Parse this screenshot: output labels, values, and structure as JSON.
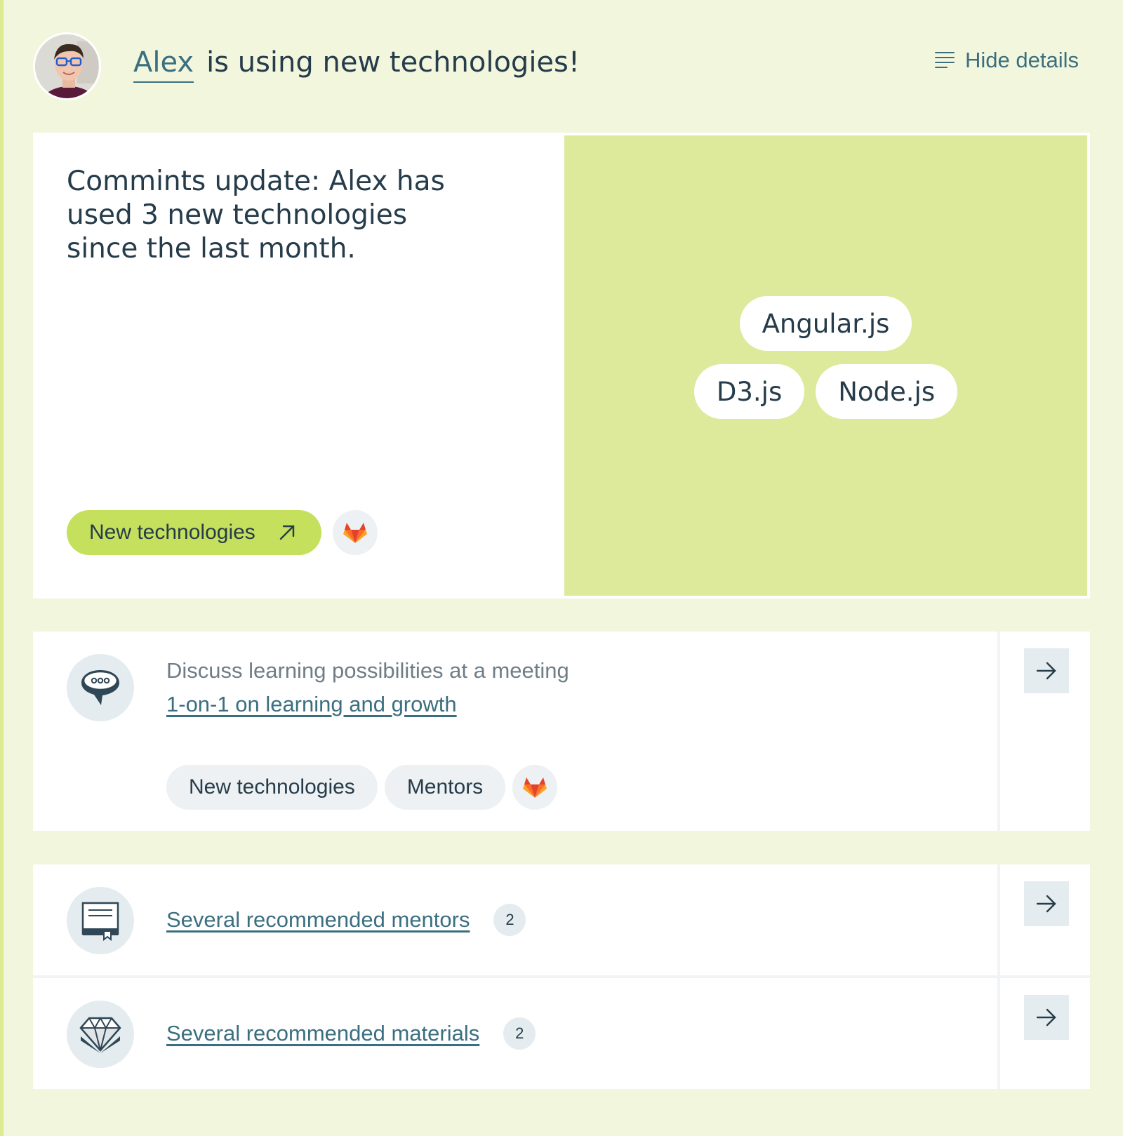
{
  "header": {
    "user_name": "Alex",
    "headline_rest": "is using new technologies!",
    "hide_details_label": "Hide details"
  },
  "insight": {
    "text": "Commints update: Alex has used 3 new technologies since the last month.",
    "primary_button_label": "New technologies",
    "technologies_row1": [
      "Angular.js"
    ],
    "technologies_row2": [
      "D3.js",
      "Node.js"
    ]
  },
  "meeting_card": {
    "subtitle": "Discuss learning possibilities at a meeting",
    "link_label": "1-on-1 on learning and growth",
    "tags": [
      "New technologies",
      "Mentors"
    ]
  },
  "recommendations": [
    {
      "label": "Several recommended mentors",
      "count": "2",
      "icon": "certificate-icon"
    },
    {
      "label": "Several recommended materials",
      "count": "2",
      "icon": "diamond-icon"
    }
  ],
  "colors": {
    "background": "#f2f6dc",
    "accent_green": "#c5e05c",
    "panel_green": "#dde99b",
    "link": "#3b6f80",
    "text": "#263c4a"
  }
}
